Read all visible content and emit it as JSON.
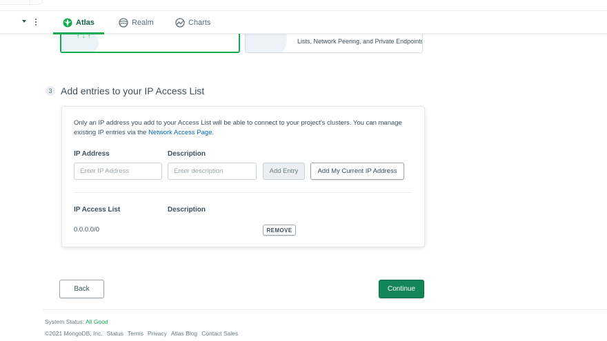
{
  "nav": {
    "tabs": [
      {
        "label": "Atlas",
        "icon": "atlas-leaf-icon",
        "active": true
      },
      {
        "label": "Realm",
        "icon": "realm-icon",
        "active": false
      },
      {
        "label": "Charts",
        "icon": "charts-icon",
        "active": false
      }
    ]
  },
  "cards": {
    "right_text": "Lists, Network Peering, and Private Endpoints."
  },
  "step": {
    "number": "3",
    "title": "Add entries to your IP Access List"
  },
  "panel": {
    "desc_text": "Only an IP address you add to your Access List will be able to connect to your project's clusters. You can manage existing IP entries via the ",
    "desc_link": "Network Access Page",
    "desc_end": ".",
    "ip_label": "IP Address",
    "desc_label": "Description",
    "ip_placeholder": "Enter IP Address",
    "desc_placeholder": "Enter description",
    "add_entry": "Add Entry",
    "add_my_ip": "Add My Current IP Address",
    "list_header_ip": "IP Access List",
    "list_header_desc": "Description",
    "entries": [
      {
        "ip": "0.0.0.0/0",
        "description": "",
        "action": "REMOVE"
      }
    ]
  },
  "actions": {
    "back": "Back",
    "continue": "Continue"
  },
  "footer": {
    "status_label": "System Status: ",
    "status_value": "All Good",
    "copyright": "©2021 MongoDB, Inc.",
    "links": [
      "Status",
      "Terms",
      "Privacy",
      "Atlas Blog",
      "Contact Sales"
    ]
  },
  "colors": {
    "brand_green": "#13aa52",
    "continue_green": "#13855a",
    "link_blue": "#006cbc"
  }
}
